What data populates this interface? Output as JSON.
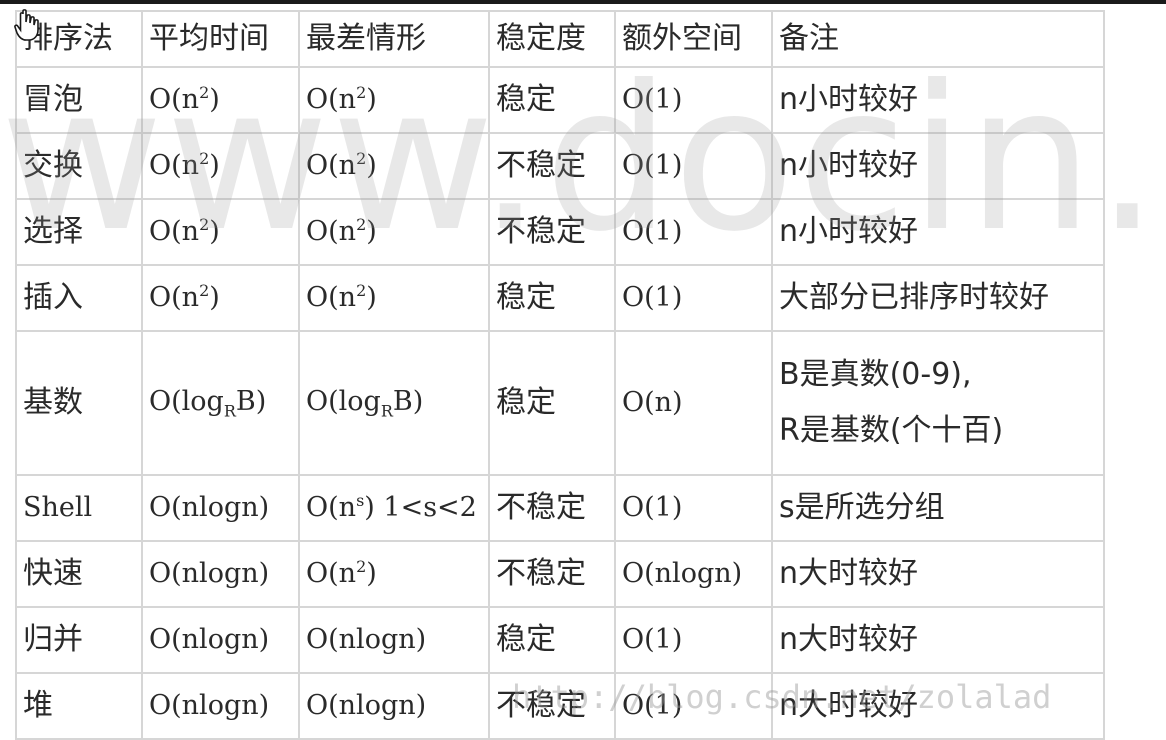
{
  "header": {
    "method": "排序法",
    "avg": "平均时间",
    "worst": "最差情形",
    "stable": "稳定度",
    "space": "额外空间",
    "note": "备注"
  },
  "rows": [
    {
      "method": "冒泡",
      "avg_base": "O(n",
      "avg_sup": "2",
      "avg_tail": ")",
      "worst_base": "O(n",
      "worst_sup": "2",
      "worst_tail": ")",
      "stable": "稳定",
      "space": "O(1)",
      "note": "n小时较好"
    },
    {
      "method": "交换",
      "avg_base": "O(n",
      "avg_sup": "2",
      "avg_tail": ")",
      "worst_base": "O(n",
      "worst_sup": "2",
      "worst_tail": ")",
      "stable": "不稳定",
      "space": "O(1)",
      "note": "n小时较好"
    },
    {
      "method": "选择",
      "avg_base": "O(n",
      "avg_sup": "2",
      "avg_tail": ")",
      "worst_base": "O(n",
      "worst_sup": "2",
      "worst_tail": ")",
      "stable": "不稳定",
      "space": "O(1)",
      "note": "n小时较好"
    },
    {
      "method": "插入",
      "avg_base": "O(n",
      "avg_sup": "2",
      "avg_tail": ")",
      "worst_base": "O(n",
      "worst_sup": "2",
      "worst_tail": ")",
      "stable": "稳定",
      "space": "O(1)",
      "note": "大部分已排序时较好"
    },
    {
      "method": "基数",
      "avg_base": "O(log",
      "avg_sub": "R",
      "avg_tail": "B)",
      "worst_base": "O(log",
      "worst_sub": "R",
      "worst_tail": "B)",
      "stable": "稳定",
      "space": "O(n)",
      "note_line1": "B是真数(0-9),",
      "note_line2": "R是基数(个十百)"
    },
    {
      "method": "Shell",
      "avg": "O(nlogn)",
      "worst_base": "O(n",
      "worst_sup": "s",
      "worst_tail": ") 1<s<2",
      "stable": "不稳定",
      "space": "O(1)",
      "note": "s是所选分组"
    },
    {
      "method": "快速",
      "avg": "O(nlogn)",
      "worst_base": "O(n",
      "worst_sup": "2",
      "worst_tail": ")",
      "stable": "不稳定",
      "space": "O(nlogn)",
      "note": "n大时较好"
    },
    {
      "method": "归并",
      "avg": "O(nlogn)",
      "worst": "O(nlogn)",
      "stable": "稳定",
      "space": "O(1)",
      "note": "n大时较好"
    },
    {
      "method": "堆",
      "avg": "O(nlogn)",
      "worst": "O(nlogn)",
      "stable": "不稳定",
      "space": "O(1)",
      "note": "n大时较好"
    }
  ],
  "watermark": {
    "large": "www.docin.co",
    "url": "http://blog.csdn.net/zolalad"
  },
  "icons": {
    "cursor": "hand-cursor-icon"
  },
  "colors": {
    "border": "#d6d6d6",
    "text": "#2a2a2a",
    "background": "#ffffff"
  }
}
